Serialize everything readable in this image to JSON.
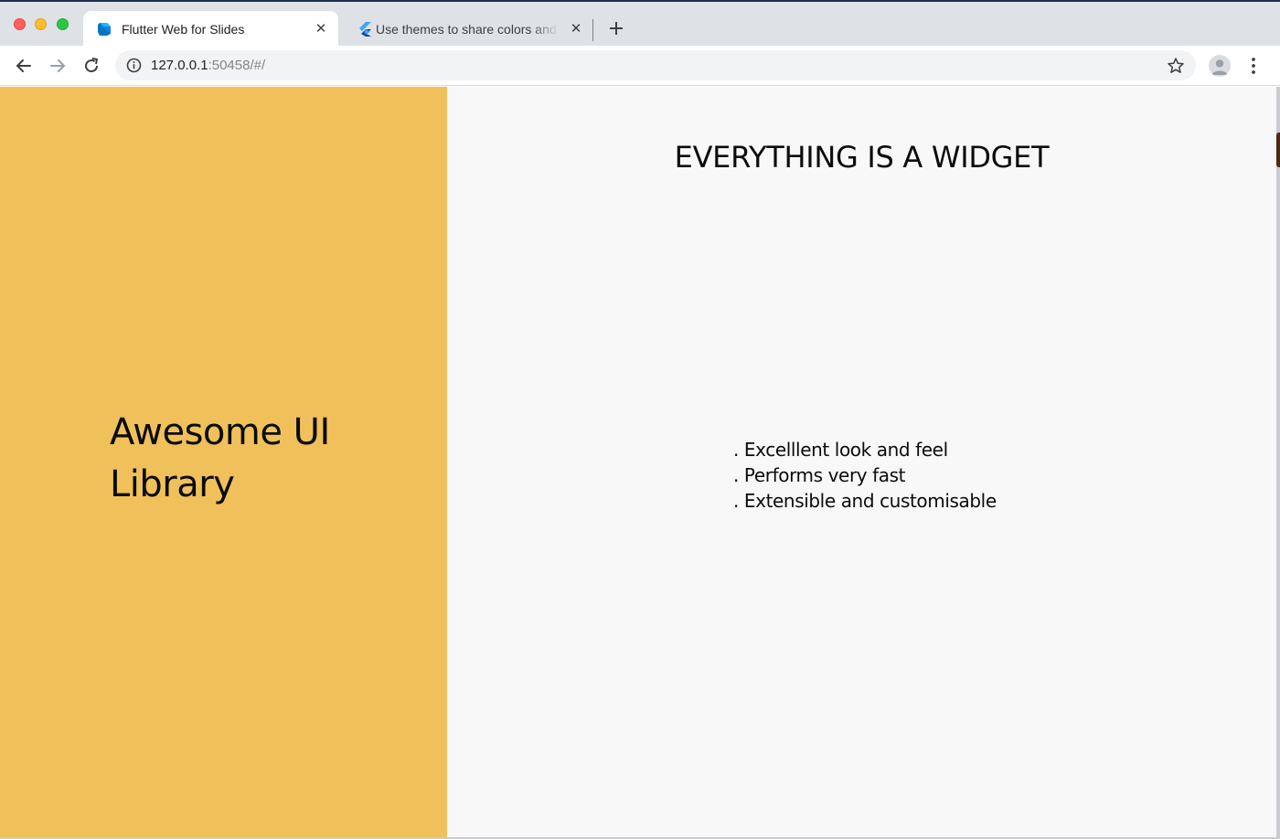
{
  "browser": {
    "tabs": [
      {
        "title": "Flutter Web for Slides",
        "favicon": "dart-icon",
        "active": true
      },
      {
        "title": "Use themes to share colors and font styles",
        "favicon": "flutter-icon",
        "active": false
      }
    ],
    "close_glyph": "✕",
    "address": {
      "host": "127.0.0.1",
      "rest": ":50458/#/"
    }
  },
  "slide": {
    "left_title": "Awesome UI Library",
    "heading": "EVERYTHING IS A WIDGET",
    "bullets": [
      ". Excelllent look and feel",
      ". Performs very fast",
      ". Extensible and customisable"
    ]
  },
  "colors": {
    "left_panel": "#f0c15a",
    "right_panel": "#f8f8f8",
    "tabstrip": "#dee1e6"
  }
}
